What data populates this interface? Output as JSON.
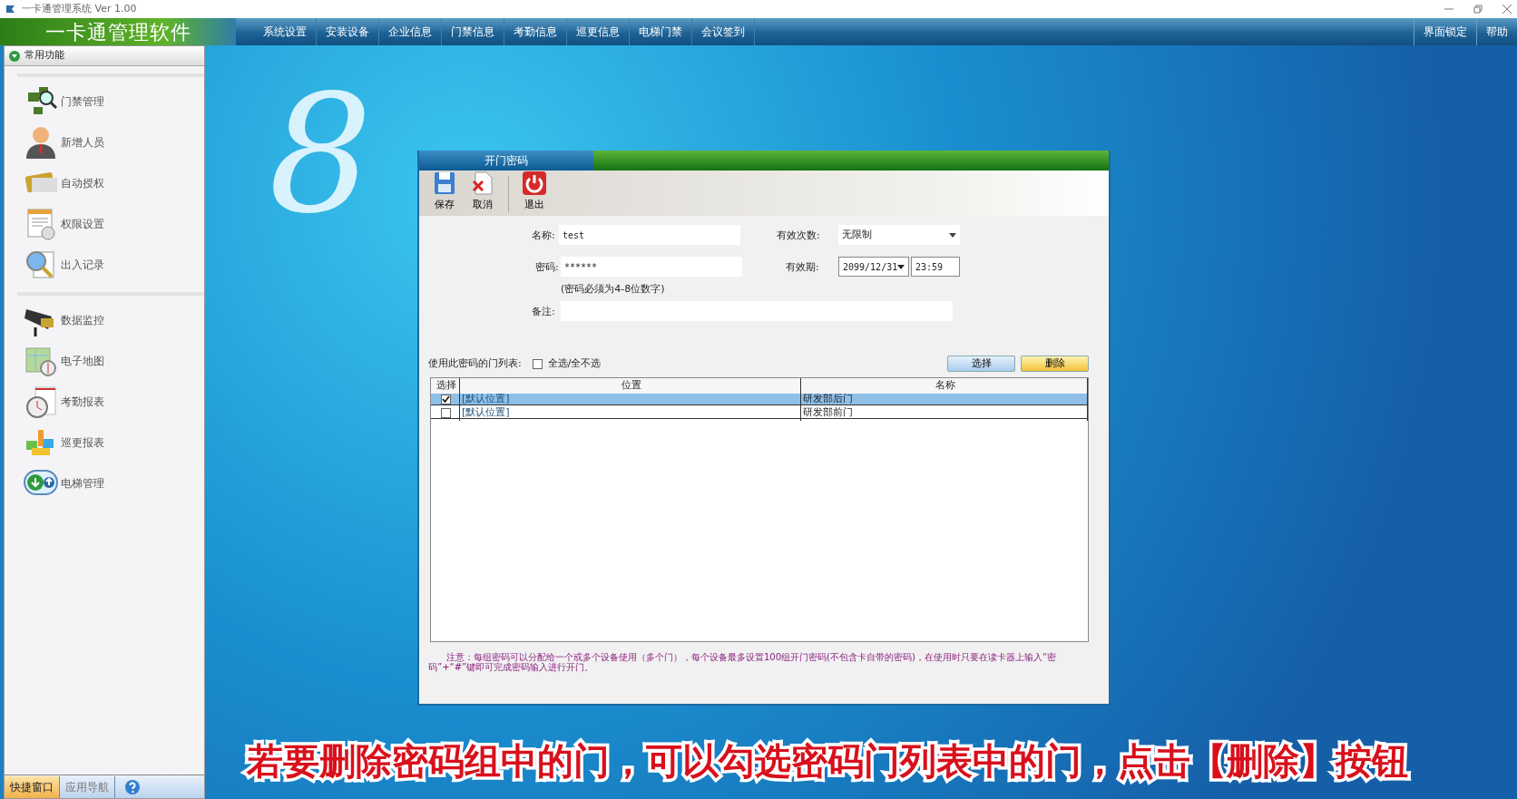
{
  "window": {
    "title": "一卡通管理系统  Ver 1.00"
  },
  "app_title": "一卡通管理软件",
  "menu": [
    {
      "label": "系统设置"
    },
    {
      "label": "安装设备"
    },
    {
      "label": "企业信息"
    },
    {
      "label": "门禁信息"
    },
    {
      "label": "考勤信息"
    },
    {
      "label": "巡更信息"
    },
    {
      "label": "电梯门禁"
    },
    {
      "label": "会议签到"
    }
  ],
  "menu_right": [
    {
      "label": "界面锁定"
    },
    {
      "label": "帮助"
    }
  ],
  "sidebar": {
    "header": "常用功能",
    "groups": [
      [
        {
          "label": "门禁管理"
        },
        {
          "label": "新增人员"
        },
        {
          "label": "自动授权"
        },
        {
          "label": "权限设置"
        },
        {
          "label": "出入记录"
        }
      ],
      [
        {
          "label": "数据监控"
        },
        {
          "label": "电子地图"
        },
        {
          "label": "考勤报表"
        },
        {
          "label": "巡更报表"
        },
        {
          "label": "电梯管理"
        }
      ]
    ]
  },
  "bottom_tabs": [
    {
      "label": "快捷窗口",
      "selected": true
    },
    {
      "label": "应用导航",
      "selected": false
    }
  ],
  "logo_mark": "8",
  "dialog": {
    "title": "开门密码",
    "toolbar": [
      {
        "label": "保存"
      },
      {
        "label": "取消"
      },
      {
        "label": "退出"
      }
    ],
    "name_label": "名称:",
    "name_value": "test",
    "count_label": "有效次数:",
    "count_value": "无限制",
    "password_label": "密码:",
    "password_value": "******",
    "password_hint": "(密码必须为4-8位数字)",
    "expiry_label": "有效期:",
    "expiry_date": "2099/12/31",
    "expiry_time": "23:59",
    "note_label": "备注:",
    "door_list_label": "使用此密码的门列表:",
    "select_all": {
      "label": "全选/全不选",
      "checked": false
    },
    "buttons": [
      {
        "label": "选择",
        "kind": "select"
      },
      {
        "label": "删除",
        "kind": "delete"
      }
    ],
    "table": {
      "columns": [
        "选择",
        "位置",
        "名称"
      ],
      "rows": [
        {
          "checked": true,
          "selected": true,
          "location": "[默认位置]",
          "name": "研发部后门"
        },
        {
          "checked": false,
          "selected": false,
          "location": "[默认位置]",
          "name": "研发部前门"
        }
      ]
    },
    "notice": "注意：每组密码可以分配给一个或多个设备使用（多个门），每个设备最多设置100组开门密码(不包含卡自带的密码)，在使用时只要在读卡器上输入“密码”+“#”键即可完成密码输入进行开门。"
  },
  "caption": "若要删除密码组中的门，可以勾选密码门列表中的门，点击【删除】按钮"
}
